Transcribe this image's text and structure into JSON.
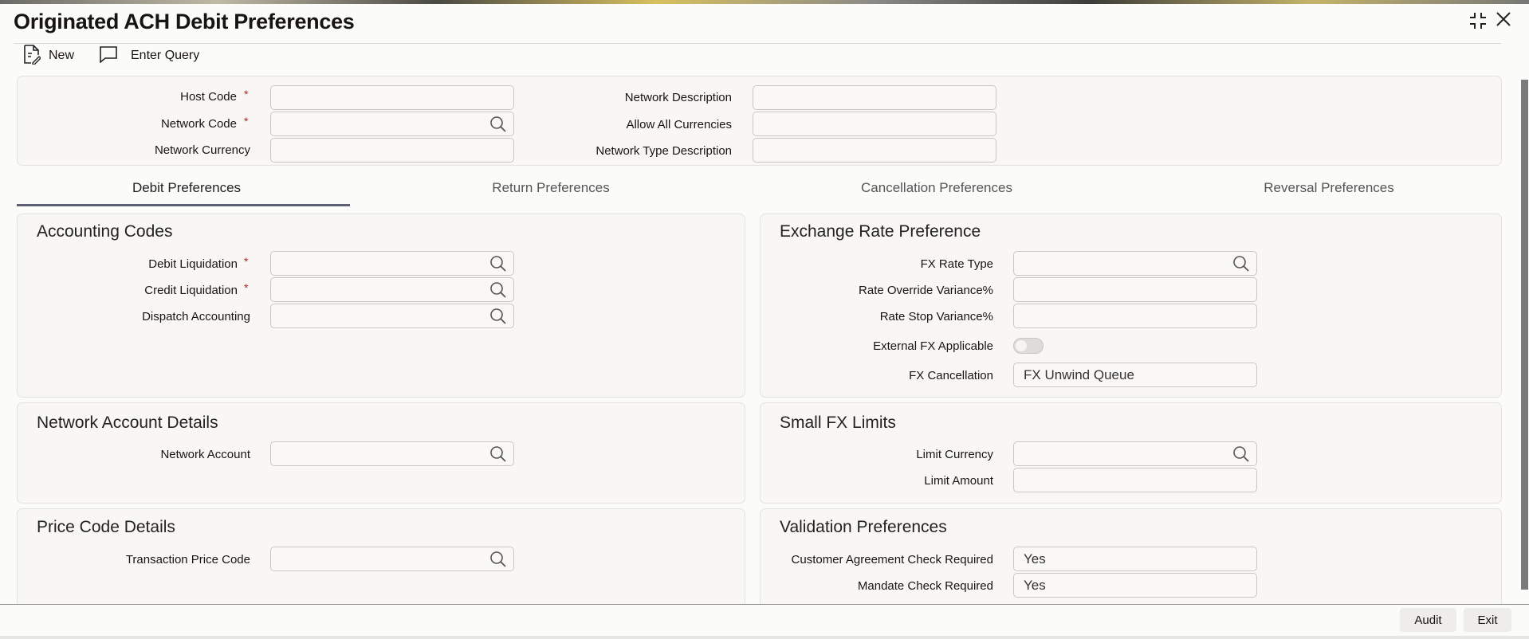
{
  "window": {
    "title": "Originated ACH Debit Preferences"
  },
  "toolbar": {
    "new": "New",
    "enter_query": "Enter Query"
  },
  "header": {
    "host_code": {
      "label": "Host Code",
      "required": "*",
      "value": ""
    },
    "network_code": {
      "label": "Network Code",
      "required": "*",
      "value": ""
    },
    "network_currency": {
      "label": "Network Currency",
      "value": ""
    },
    "network_description": {
      "label": "Network Description",
      "value": ""
    },
    "allow_all_currencies": {
      "label": "Allow All Currencies",
      "value": ""
    },
    "network_type_description": {
      "label": "Network Type Description",
      "value": ""
    }
  },
  "tabs": [
    "Debit Preferences",
    "Return Preferences",
    "Cancellation Preferences",
    "Reversal Preferences"
  ],
  "accounting": {
    "title": "Accounting Codes",
    "debit_liquidation": "Debit Liquidation",
    "credit_liquidation": "Credit Liquidation",
    "dispatch_accounting": "Dispatch Accounting",
    "required": "*"
  },
  "exchange": {
    "title": "Exchange Rate Preference",
    "fx_rate_type": "FX Rate Type",
    "rate_override": "Rate Override Variance%",
    "rate_stop": "Rate Stop Variance%",
    "external_fx": "External FX Applicable",
    "external_fx_on": false,
    "fx_cancellation": "FX Cancellation",
    "fx_cancellation_value": "FX Unwind Queue"
  },
  "network_account": {
    "title": "Network Account Details",
    "network_account": "Network Account"
  },
  "small_fx": {
    "title": "Small FX Limits",
    "limit_currency": "Limit Currency",
    "limit_amount": "Limit Amount"
  },
  "price_code": {
    "title": "Price Code Details",
    "transaction_price_code": "Transaction Price Code"
  },
  "validation": {
    "title": "Validation Preferences",
    "customer_agreement": "Customer Agreement Check Required",
    "customer_agreement_value": "Yes",
    "mandate_check": "Mandate Check Required",
    "mandate_check_value": "Yes"
  },
  "footer": {
    "audit": "Audit",
    "exit": "Exit"
  }
}
